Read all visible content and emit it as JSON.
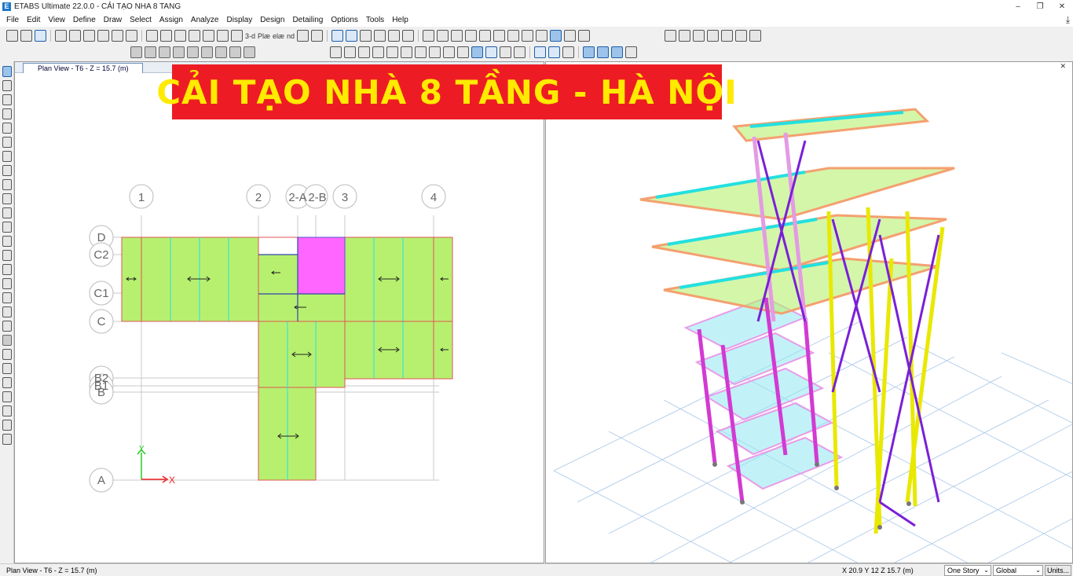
{
  "window": {
    "title": "ETABS Ultimate 22.0.0 - CẢI TẠO NHA 8 TANG",
    "app_icon": "E"
  },
  "menu": [
    "File",
    "Edit",
    "View",
    "Define",
    "Draw",
    "Select",
    "Assign",
    "Analyze",
    "Display",
    "Design",
    "Detailing",
    "Options",
    "Tools",
    "Help"
  ],
  "toolbar": {
    "view_3d": "3-d",
    "plan": "Plæ",
    "elev": "elæ",
    "nd": "nd"
  },
  "left_pane": {
    "tab": "Plan View - T6 - Z = 15.7 (m)",
    "grid_x": [
      {
        "label": "1"
      },
      {
        "label": "2"
      },
      {
        "label": "2-A"
      },
      {
        "label": "2-B"
      },
      {
        "label": "3"
      },
      {
        "label": "4"
      }
    ],
    "grid_y": [
      {
        "label": "D"
      },
      {
        "label": "C2"
      },
      {
        "label": "C1"
      },
      {
        "label": "C"
      },
      {
        "label": "B2"
      },
      {
        "label": "B1"
      },
      {
        "label": "B"
      },
      {
        "label": "A"
      }
    ],
    "axis_x_label": "X",
    "axis_y_label": "Y"
  },
  "banner": {
    "text": "CẢI TẠO NHÀ 8 TẦNG - HÀ NỘI",
    "bg_color": "#ed1c24",
    "text_color": "#ffea00"
  },
  "status": {
    "left": "Plan View - T6 - Z = 15.7 (m)",
    "coords": "X 20.9  Y 12  Z 15.7 (m)",
    "story_select": "One Story",
    "coord_select": "Global",
    "units_button": "Units..."
  },
  "colors": {
    "slab_green": "#b7f06f",
    "slab_magenta": "#ff66ff",
    "beam_cyan": "#23e0e0",
    "beam_red": "#ff6b6b",
    "column_magenta": "#d23ad2",
    "column_yellow": "#e8e800",
    "brace_purple": "#7a1fd8"
  }
}
